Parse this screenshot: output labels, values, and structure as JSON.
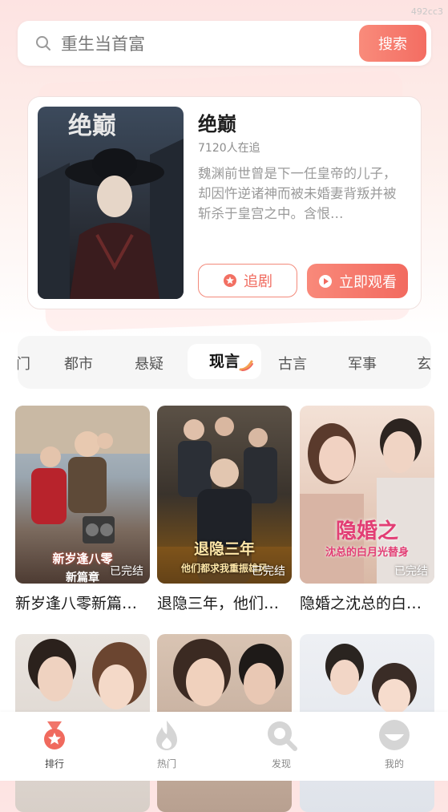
{
  "watermark": "492cc3",
  "search": {
    "placeholder": "重生当首富",
    "button_label": "搜索"
  },
  "featured": {
    "title": "绝巅",
    "poster_text": "绝巅",
    "followers": "7120人在追",
    "description": "魏渊前世曾是下一任皇帝的儿子，却因忤逆诸神而被未婚妻背叛并被斩杀于皇宫之中。含恨…",
    "follow_label": "追剧",
    "watch_label": "立即观看"
  },
  "tabs": [
    {
      "label": "门"
    },
    {
      "label": "都市"
    },
    {
      "label": "悬疑"
    },
    {
      "label": "现言"
    },
    {
      "label": "古言"
    },
    {
      "label": "军事"
    },
    {
      "label": "玄"
    }
  ],
  "active_tab": "现言",
  "grid": [
    {
      "title": "新岁逢八零新篇…",
      "status": "已完结",
      "overlay": "新岁逢八零",
      "overlay_sub": "新篇章"
    },
    {
      "title": "退隐三年，他们…",
      "status": "已完结",
      "overlay": "退隐三年",
      "overlay_sub": "他们都求我重振雄风"
    },
    {
      "title": "隐婚之沈总的白…",
      "status": "已完结",
      "overlay": "隐婚之",
      "overlay_sub": "沈总的白月光替身"
    },
    {
      "title": "",
      "status": "",
      "overlay": "",
      "overlay_sub": ""
    },
    {
      "title": "",
      "status": "",
      "overlay": "",
      "overlay_sub": ""
    },
    {
      "title": "",
      "status": "",
      "overlay": "",
      "overlay_sub": ""
    }
  ],
  "nav": [
    {
      "label": "排行",
      "icon": "ranking-medal-icon"
    },
    {
      "label": "热门",
      "icon": "flame-icon"
    },
    {
      "label": "发现",
      "icon": "discover-search-icon"
    },
    {
      "label": "我的",
      "icon": "profile-icon"
    }
  ],
  "colors": {
    "accent": "#f36d62",
    "accent_light": "#f98b7b",
    "nav_inactive": "#d5d5d5"
  }
}
